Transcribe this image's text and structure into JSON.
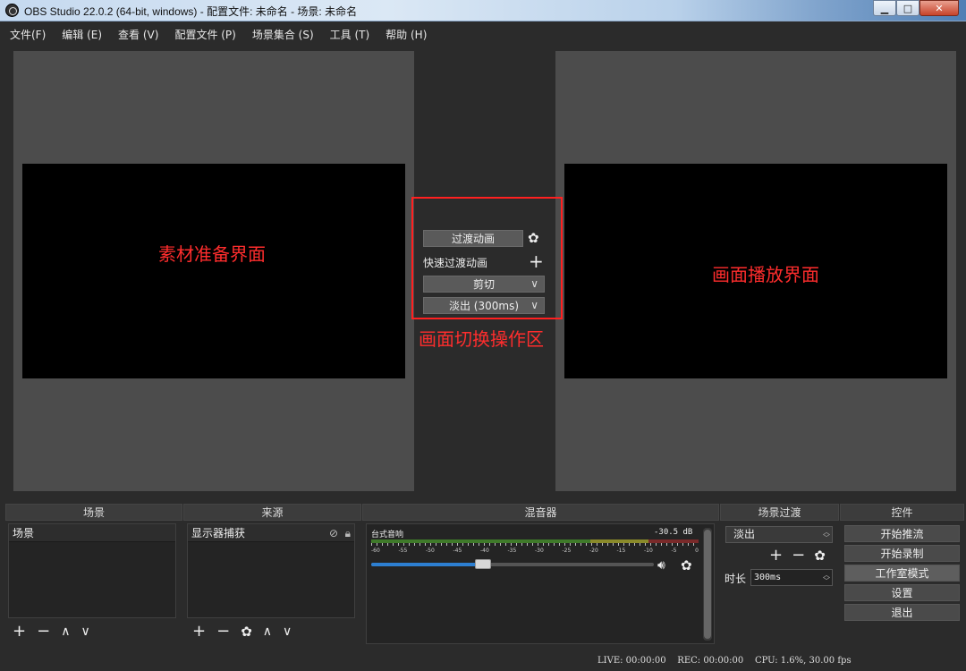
{
  "window": {
    "title": "OBS Studio 22.0.2 (64-bit, windows) - 配置文件: 未命名 - 场景: 未命名",
    "minimize": "▁",
    "maximize": "□",
    "close": "✕"
  },
  "menu": [
    "文件(F)",
    "编辑 (E)",
    "查看 (V)",
    "配置文件 (P)",
    "场景集合 (S)",
    "工具 (T)",
    "帮助 (H)"
  ],
  "preview": {
    "left_label": "素材准备界面",
    "right_label": "画面播放界面"
  },
  "transition": {
    "button": "过渡动画",
    "quick_label": "快速过渡动画",
    "cut": "剪切",
    "fade": "淡出 (300ms)",
    "caption": "画面切换操作区"
  },
  "docks": {
    "scenes": {
      "header": "场景",
      "items": [
        "场景"
      ]
    },
    "sources": {
      "header": "来源",
      "items": [
        "显示器捕获"
      ]
    },
    "mixer": {
      "header": "混音器",
      "channel": "台式音响",
      "db": "-30.5 dB",
      "scale": [
        "-60",
        "-55",
        "-50",
        "-45",
        "-40",
        "-35",
        "-30",
        "-25",
        "-20",
        "-15",
        "-10",
        "-5",
        "0"
      ],
      "volume": 0.25
    },
    "scene_transitions": {
      "header": "场景过渡",
      "selected": "淡出",
      "duration_label": "时长",
      "duration": "300ms"
    },
    "controls": {
      "header": "控件",
      "buttons": [
        "开始推流",
        "开始录制",
        "工作室模式",
        "设置",
        "退出"
      ]
    }
  },
  "status": {
    "text": "LIVE: 00:00:00    REC: 00:00:00    CPU: 1.6%, 30.00 fps"
  }
}
